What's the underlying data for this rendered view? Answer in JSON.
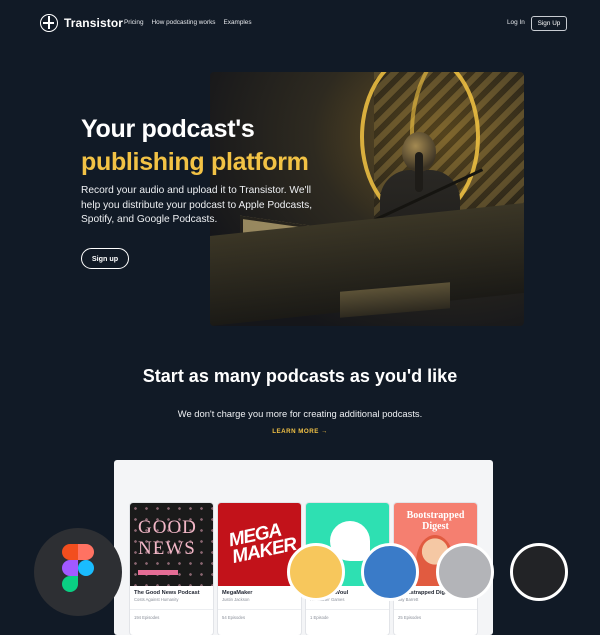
{
  "nav": {
    "brand": "Transistor",
    "links": [
      "Pricing",
      "How podcasting works",
      "Examples"
    ],
    "login": "Log In",
    "signup": "Sign Up"
  },
  "hero": {
    "title_line1": "Your podcast's",
    "title_line2": "publishing platform",
    "description": "Record your audio and upload it to Transistor. We'll help you distribute your podcast to Apple Podcasts, Spotify, and Google Podcasts.",
    "cta": "Sign up"
  },
  "section": {
    "title": "Start as many podcasts as you'd like",
    "subtitle": "We don't charge you more for creating additional podcasts.",
    "learn_more": "LEARN MORE →"
  },
  "podcasts": [
    {
      "name": "The Good News Podcast",
      "author": "Costs Against Humanity",
      "episodes": "194 Episodes",
      "art_text": "GOOD NEWS"
    },
    {
      "name": "MegaMaker",
      "author": "Justin Jackson",
      "episodes": "54 Episodes",
      "art_text": "MEGA MAKER"
    },
    {
      "name": "Two Two Woul",
      "author": "Kickstarter Games",
      "episodes": "1 Episode",
      "art_text": ""
    },
    {
      "name": "Bootstrapped Dige",
      "author": "Jay Barrett",
      "episodes": "25 Episodes",
      "art_text": "Bootstrapped Digest"
    }
  ],
  "colors": {
    "background": "#111a26",
    "accent": "#f2c245",
    "swatches": [
      "#f7c75c",
      "#3a7bc8",
      "#b3b4b8",
      "#222326"
    ]
  },
  "icons": {
    "brand": "transistor-logo-icon",
    "overlay": "figma-icon"
  }
}
